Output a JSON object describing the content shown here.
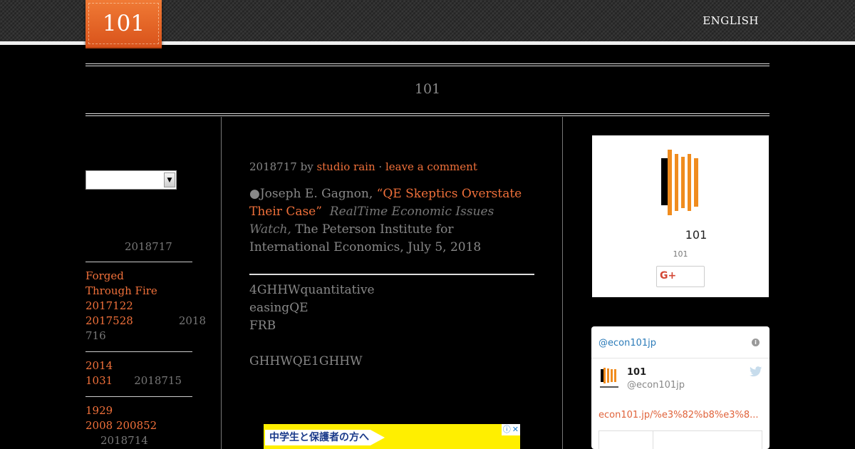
{
  "header": {
    "logo_text": "101",
    "language_link": "ENGLISH"
  },
  "site": {
    "title": "101"
  },
  "sidebar_left": {
    "archive_select_value": "",
    "entries": [
      {
        "orange": "",
        "muted": "2018717"
      },
      {
        "orange_lines": [
          " Forged",
          "Through Fire",
          "2017122",
          "2017528"
        ],
        "muted_inline": "2018",
        "muted_after": "716"
      },
      {
        "orange_lines": [
          " 2014",
          "1031"
        ],
        "muted_inline": "2018715"
      },
      {
        "orange_lines": [
          " 1929",
          "2008 200852"
        ],
        "muted_after": "2018714"
      }
    ]
  },
  "post": {
    "date": "2018717",
    "by": "by",
    "author": "studio rain",
    "separator": "·",
    "comment_link": "leave a comment",
    "quote_bullet": "●",
    "quote_author": "Joseph E. Gagnon, ",
    "quote_open": "“",
    "quote_title": "QE Skeptics Overstate Their Case",
    "quote_close": "”",
    "quote_source": "RealTime Economic Issues Watch,",
    "quote_rest": " The Peterson Institute for International Economics, July 5, 2018",
    "para1_lines": [
      "4GHHWquantitative",
      "easingQE",
      "FRB"
    ],
    "para2": "GHHWQE1GHHW"
  },
  "ad": {
    "label": "中学生と保護者の方へ",
    "info_icon": "ⓘ",
    "close_icon": "✕"
  },
  "profile_card": {
    "name": "101",
    "subtitle": "101",
    "gplus_label": "G+"
  },
  "twitter": {
    "header_handle": "@econ101jp",
    "name": "101",
    "handle": "@econ101jp",
    "link": "econ101.jp/%e3%82%b8%e3%8..."
  },
  "colors": {
    "accent_orange": "#f0703a",
    "background": "#000000",
    "muted_text": "#888888"
  }
}
